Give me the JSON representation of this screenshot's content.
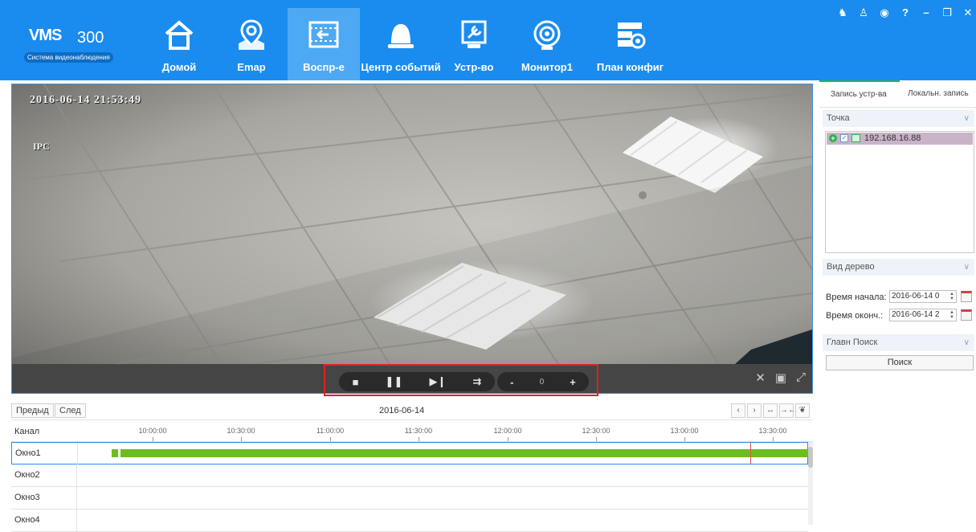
{
  "app": {
    "logo_brand": "VMS",
    "logo_number": "300",
    "logo_subtitle": "Система видеонаблюдения"
  },
  "nav": [
    {
      "label": "Домой",
      "icon": "home-icon"
    },
    {
      "label": "Emap",
      "icon": "map-pin-icon"
    },
    {
      "label": "Воспр-е",
      "icon": "playback-icon",
      "active": true
    },
    {
      "label": "Центр событий",
      "icon": "alarm-bell-icon"
    },
    {
      "label": "Устр-во",
      "icon": "wrench-icon"
    },
    {
      "label": "Монитор1",
      "icon": "monitor-icon"
    },
    {
      "label": "План конфиг",
      "icon": "schedule-config-icon"
    }
  ],
  "window_controls": [
    "tshirt-icon",
    "user-icon",
    "lock-icon",
    "help-icon",
    "minimize-icon",
    "restore-icon",
    "close-icon"
  ],
  "video": {
    "osd_timestamp": "2016-06-14 21:53:49",
    "osd_camera": "IPC"
  },
  "playback": {
    "speed_value": "0",
    "buttons": [
      "stop",
      "pause",
      "next-frame",
      "step",
      "slower",
      "faster"
    ]
  },
  "timeline": {
    "prev_label": "Предыд",
    "next_label": "След",
    "date": "2016-06-14",
    "channel_header": "Канал",
    "ticks": [
      "10:00:00",
      "10:30:00",
      "11:00:00",
      "11:30:00",
      "12:00:00",
      "12:30:00",
      "13:00:00",
      "13:30:00"
    ],
    "rows": [
      {
        "name": "Окно1",
        "has_recording": true
      },
      {
        "name": "Окно2",
        "has_recording": false
      },
      {
        "name": "Окно3",
        "has_recording": false
      },
      {
        "name": "Окно4",
        "has_recording": false
      }
    ]
  },
  "right_panel": {
    "tab_device_record": "Запись устр-ва",
    "tab_local_record": "Локальн. запись",
    "section_point": "Точка",
    "device_ip": "192.168.16.88",
    "section_tree_view": "Вид дерево",
    "start_time_label": "Время начала:",
    "start_time_value": "2016-06-14 0",
    "end_time_label": "Время оконч.:",
    "end_time_value": "2016-06-14 2",
    "section_main_search": "Главн Поиск",
    "search_button": "Поиск"
  },
  "colors": {
    "topbar": "#1a8cf0",
    "active_nav": "#4ea9f4",
    "recording": "#6cbd1d",
    "highlight_frame": "#dd2222",
    "active_tab": "#2db34a"
  }
}
